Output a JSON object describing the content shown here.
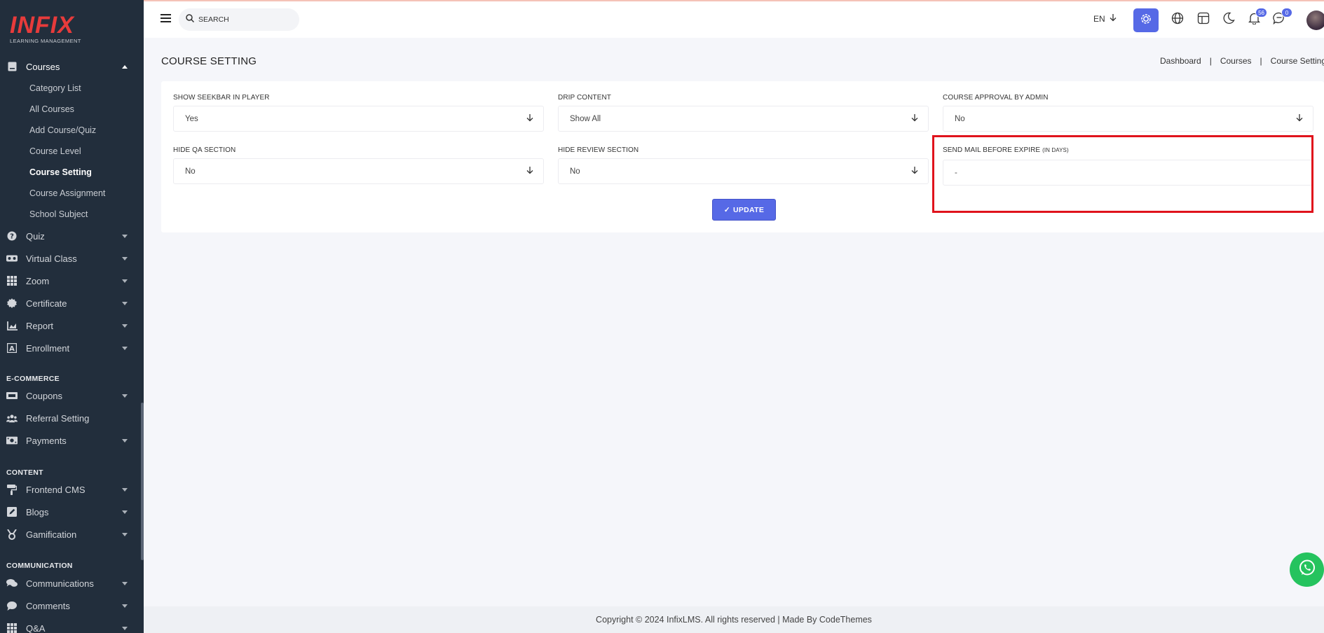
{
  "logo": {
    "main": "INFIX",
    "sub": "LEARNING MANAGEMENT"
  },
  "sidebar": {
    "courses": {
      "label": "Courses",
      "sub_items": [
        "Category List",
        "All Courses",
        "Add Course/Quiz",
        "Course Level",
        "Course Setting",
        "Course Assignment",
        "School Subject"
      ]
    },
    "items": [
      {
        "label": "Quiz",
        "icon": "question-icon"
      },
      {
        "label": "Virtual Class",
        "icon": "vr-icon"
      },
      {
        "label": "Zoom",
        "icon": "grid-icon"
      },
      {
        "label": "Certificate",
        "icon": "certificate-icon"
      },
      {
        "label": "Report",
        "icon": "report-icon"
      },
      {
        "label": "Enrollment",
        "icon": "enrollment-icon"
      }
    ],
    "ecommerce_label": "E-COMMERCE",
    "ecommerce_items": [
      {
        "label": "Coupons",
        "icon": "coupon-icon"
      },
      {
        "label": "Referral Setting",
        "icon": "referral-icon"
      },
      {
        "label": "Payments",
        "icon": "payment-icon"
      }
    ],
    "content_label": "CONTENT",
    "content_items": [
      {
        "label": "Frontend CMS",
        "icon": "paint-roller-icon"
      },
      {
        "label": "Blogs",
        "icon": "blog-icon"
      },
      {
        "label": "Gamification",
        "icon": "medal-icon"
      }
    ],
    "communication_label": "COMMUNICATION",
    "communication_items": [
      {
        "label": "Communications",
        "icon": "chat-icon"
      },
      {
        "label": "Comments",
        "icon": "comment-icon"
      },
      {
        "label": "Q&A",
        "icon": "grid-icon"
      }
    ]
  },
  "header": {
    "search_placeholder": "SEARCH",
    "language": "EN",
    "notifications_count": "56",
    "messages_count": "0"
  },
  "page": {
    "title": "COURSE SETTING",
    "breadcrumb": [
      "Dashboard",
      "Courses",
      "Course Setting"
    ]
  },
  "form": {
    "show_seekbar": {
      "label": "SHOW SEEKBAR IN PLAYER",
      "value": "Yes"
    },
    "drip_content": {
      "label": "DRIP CONTENT",
      "value": "Show All"
    },
    "course_approval": {
      "label": "COURSE APPROVAL BY ADMIN",
      "value": "No"
    },
    "hide_qa": {
      "label": "HIDE QA SECTION",
      "value": "No"
    },
    "hide_review": {
      "label": "HIDE REVIEW SECTION",
      "value": "No"
    },
    "send_mail": {
      "label": "SEND MAIL BEFORE EXPIRE",
      "label_suffix": "(IN DAYS)",
      "value": "-"
    },
    "update_label": "UPDATE"
  },
  "footer": {
    "text": "Copyright © 2024 InfixLMS. All rights reserved | Made By CodeThemes"
  },
  "colors": {
    "primary": "#5669e6",
    "sidebar_bg": "#222e3c",
    "logo_red": "#e73b3b",
    "highlight_red": "#e0131c",
    "whatsapp": "#25c35e"
  }
}
